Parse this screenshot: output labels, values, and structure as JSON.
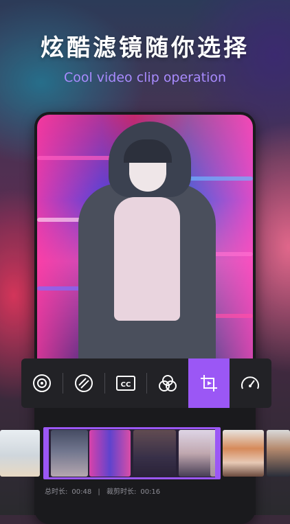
{
  "headline": "炫酷滤镜随你选择",
  "subline": "Cool video clip operation",
  "colors": {
    "accent": "#9b57f5",
    "subline": "#a98bff",
    "panel": "#222226"
  },
  "toolbar": {
    "tools": [
      {
        "icon": "vinyl-disc-icon",
        "active": false
      },
      {
        "icon": "sticker-icon",
        "active": false
      },
      {
        "icon": "closed-caption-icon",
        "active": false
      },
      {
        "icon": "filter-circles-icon",
        "active": false
      },
      {
        "icon": "crop-video-icon",
        "active": true
      },
      {
        "icon": "speedometer-icon",
        "active": false
      }
    ]
  },
  "timeline": {
    "total_label": "总时长:",
    "total_value": "00:48",
    "divider": "|",
    "trim_label": "裁剪时长:",
    "trim_value": "00:16"
  }
}
